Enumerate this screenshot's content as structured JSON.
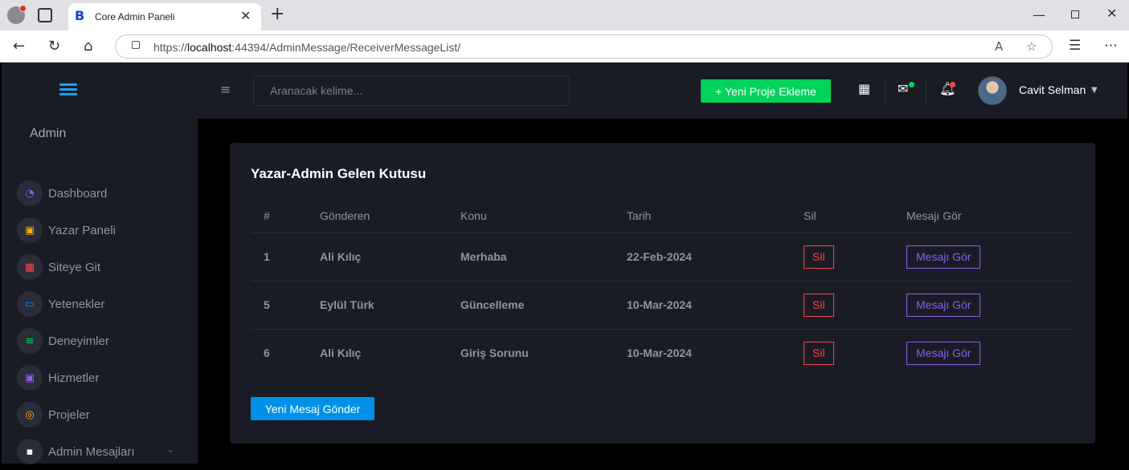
{
  "browser": {
    "tab_title": "Core Admin Paneli",
    "tab_favicon": "B",
    "url_prefix": "https://",
    "url_host": "localhost",
    "url_rest": ":44394/AdminMessage/ReceiverMessageList/"
  },
  "sidebar": {
    "admin_name": "Admin",
    "items": [
      {
        "label": "Dashboard",
        "icon": "speedometer-icon",
        "color": "#8f5fe8",
        "glyph": "◔"
      },
      {
        "label": "Yazar Paneli",
        "icon": "message-alert-icon",
        "color": "#ffab00",
        "glyph": "▣"
      },
      {
        "label": "Siteye Git",
        "icon": "table-icon",
        "color": "#fc424a",
        "glyph": "▦"
      },
      {
        "label": "Yetenekler",
        "icon": "laptop-icon",
        "color": "#0090e7",
        "glyph": "▭"
      },
      {
        "label": "Deneyimler",
        "icon": "playlist-icon",
        "color": "#00d25b",
        "glyph": "≡"
      },
      {
        "label": "Hizmetler",
        "icon": "contacts-icon",
        "color": "#8f5fe8",
        "glyph": "▣"
      },
      {
        "label": "Projeler",
        "icon": "github-icon",
        "color": "#ffab00",
        "glyph": "◎"
      },
      {
        "label": "Admin Mesajları",
        "icon": "chat-icon",
        "color": "#ffffff",
        "glyph": "▪"
      }
    ]
  },
  "topbar": {
    "search_placeholder": "Aranacak kelime...",
    "new_project_label": "+ Yeni Proje Ekleme",
    "user_name": "Cavit Selman"
  },
  "card": {
    "title": "Yazar-Admin Gelen Kutusu",
    "columns": [
      "#",
      "Gönderen",
      "Konu",
      "Tarih",
      "Sil",
      "Mesajı Gör"
    ],
    "rows": [
      {
        "id": "1",
        "sender": "Ali Kılıç",
        "subject": "Merhaba",
        "date": "22-Feb-2024",
        "delete_label": "Sil",
        "view_label": "Mesajı Gör"
      },
      {
        "id": "5",
        "sender": "Eylül Türk",
        "subject": "Güncelleme",
        "date": "10-Mar-2024",
        "delete_label": "Sil",
        "view_label": "Mesajı Gör"
      },
      {
        "id": "6",
        "sender": "Ali Kılıç",
        "subject": "Giriş Sorunu",
        "date": "10-Mar-2024",
        "delete_label": "Sil",
        "view_label": "Mesajı Gör"
      }
    ],
    "send_button_label": "Yeni Mesaj Gönder"
  },
  "colors": {
    "success": "#00d25b",
    "danger": "#fc424a",
    "primary": "#0090e7",
    "purple": "#8f5fe8",
    "panel": "#191c24"
  }
}
